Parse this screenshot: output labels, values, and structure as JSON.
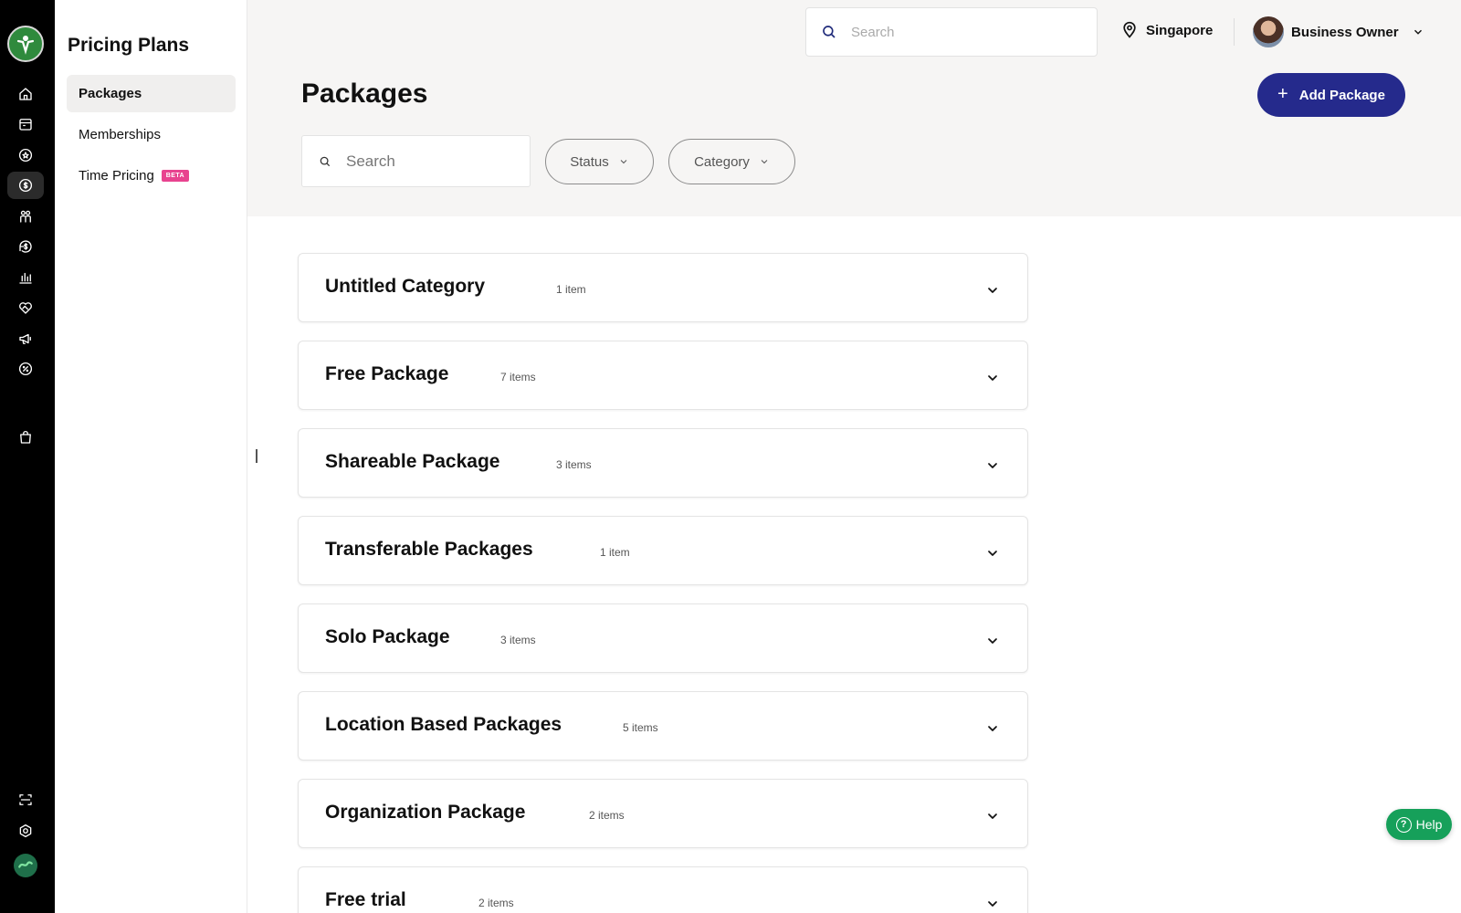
{
  "rail": {
    "icons": [
      "home-icon",
      "calendar-icon",
      "star-badge-icon",
      "pricing-icon",
      "members-icon",
      "refund-icon",
      "analytics-icon",
      "partnership-icon",
      "marketing-icon",
      "discount-icon",
      "shop-bag-icon",
      "scan-icon",
      "settings-icon",
      "brand-icon"
    ],
    "active": "pricing-icon"
  },
  "subnav": {
    "title": "Pricing Plans",
    "items": [
      {
        "label": "Packages",
        "active": true
      },
      {
        "label": "Memberships",
        "active": false
      },
      {
        "label": "Time Pricing",
        "active": false,
        "badge": "BETA"
      }
    ]
  },
  "header": {
    "search_placeholder": "Search",
    "location": "Singapore",
    "user_name": "Business Owner"
  },
  "page": {
    "title": "Packages",
    "add_button": "Add Package",
    "plus": "+",
    "search_placeholder": "Search",
    "filters": [
      "Status",
      "Category"
    ]
  },
  "categories": [
    {
      "name": "Untitled Category",
      "count": "1 item"
    },
    {
      "name": "Free Package",
      "count": "7 items"
    },
    {
      "name": "Shareable Package",
      "count": "3 items"
    },
    {
      "name": "Transferable Packages",
      "count": "1 item"
    },
    {
      "name": "Solo Package",
      "count": "3 items"
    },
    {
      "name": "Location Based Packages",
      "count": "5 items"
    },
    {
      "name": "Organization Package",
      "count": "2 items"
    },
    {
      "name": "Free trial",
      "count": "2 items"
    }
  ],
  "help": {
    "label": "Help",
    "q": "?"
  },
  "colors": {
    "accent": "#252a8c",
    "help": "#16a05a",
    "beta": "#e8438f",
    "rail": "#000000"
  }
}
